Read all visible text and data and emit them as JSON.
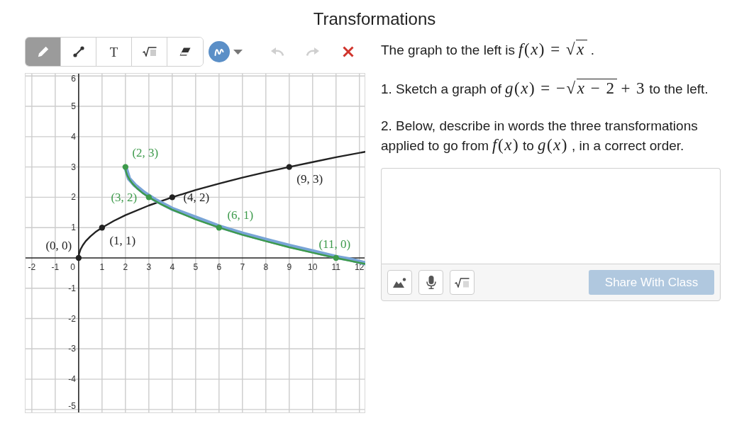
{
  "title": "Transformations",
  "toolbar": {
    "tools": [
      {
        "kind": "pencil",
        "selected": true
      },
      {
        "kind": "segment",
        "selected": false
      },
      {
        "kind": "text",
        "label": "T",
        "selected": false
      },
      {
        "kind": "math",
        "selected": false
      },
      {
        "kind": "eraser",
        "selected": false
      }
    ],
    "color_picker": {
      "color": "#5b8fc7"
    },
    "actions": [
      {
        "kind": "undo",
        "disabled": true
      },
      {
        "kind": "redo",
        "disabled": true
      },
      {
        "kind": "clear",
        "disabled": false
      }
    ]
  },
  "graph": {
    "chart_data": {
      "type": "line",
      "xlim": [
        -2.3,
        12.25
      ],
      "ylim": [
        -5.12,
        6.1
      ],
      "xticks": [
        -2,
        -1,
        0,
        1,
        2,
        3,
        4,
        5,
        6,
        7,
        8,
        9,
        10,
        11,
        12
      ],
      "yticks": [
        -5,
        -4,
        -3,
        -2,
        -1,
        1,
        2,
        3,
        4,
        5,
        6
      ],
      "grid": true,
      "series": [
        {
          "type": "line",
          "color": "#222222",
          "x": [
            0,
            0.02,
            0.08,
            0.18,
            0.3,
            0.5,
            0.75,
            1,
            1.5,
            2,
            3,
            4,
            5,
            6,
            7,
            8,
            9,
            10,
            11,
            12.25
          ],
          "values": [
            0,
            0.14,
            0.28,
            0.42,
            0.55,
            0.71,
            0.87,
            1,
            1.22,
            1.41,
            1.73,
            2,
            2.24,
            2.45,
            2.65,
            2.83,
            3,
            3.16,
            3.32,
            3.5
          ]
        },
        {
          "type": "line",
          "color": "#78a4d6",
          "x": [
            2,
            2.15,
            2.4,
            2.8,
            3.3,
            4,
            5,
            6,
            7,
            8,
            9,
            10,
            11,
            11.6,
            12.25
          ],
          "values": [
            3,
            2.62,
            2.4,
            2.15,
            1.9,
            1.62,
            1.33,
            1.04,
            0.8,
            0.6,
            0.4,
            0.22,
            0.03,
            -0.05,
            -0.18
          ]
        },
        {
          "type": "line",
          "color": "#3d9a4b",
          "x": [
            2,
            2.02,
            2.08,
            2.18,
            2.3,
            2.5,
            2.75,
            3,
            3.5,
            4,
            5,
            6,
            7,
            8,
            9,
            10,
            11,
            12.25
          ],
          "values": [
            3,
            2.86,
            2.72,
            2.58,
            2.45,
            2.29,
            2.13,
            2,
            1.78,
            1.59,
            1.27,
            1,
            0.76,
            0.55,
            0.35,
            0.17,
            0,
            -0.2
          ]
        },
        {
          "type": "scatter",
          "color": "#222222",
          "x": [
            0,
            1,
            4,
            9
          ],
          "values": [
            0,
            1,
            2,
            3
          ],
          "value_labels": [
            "(0, 0)",
            "(1, 1)",
            "(4, 2)",
            "(9, 3)"
          ]
        },
        {
          "type": "scatter",
          "color": "#3d9a4b",
          "x": [
            2,
            3,
            6,
            11
          ],
          "values": [
            3,
            2,
            1,
            0
          ],
          "value_labels": [
            "(2, 3)",
            "(3, 2)",
            "(6, 1)",
            "(11, 0)"
          ]
        }
      ]
    }
  },
  "instructions": [
    {
      "segments": [
        {
          "kind": "text",
          "text": "The graph to the left is"
        },
        {
          "kind": "math",
          "text": "*f*(*x*) = "
        },
        {
          "kind": "sqrt",
          "sign": "√",
          "text": "*x*"
        },
        {
          "kind": "text",
          "text": "."
        }
      ]
    },
    {
      "segments": [
        {
          "kind": "text",
          "text": "1. Sketch a graph of"
        },
        {
          "kind": "math",
          "text": "*g*(*x*) = −"
        },
        {
          "kind": "sqrt",
          "sign": "√",
          "text": "*x* − 2"
        },
        {
          "kind": "math",
          "text": "+ 3"
        },
        {
          "kind": "text",
          "text": "to the left."
        }
      ]
    },
    {
      "segments": [
        {
          "kind": "text",
          "text": "2. Below, describe in words the three transformations applied to go from"
        },
        {
          "kind": "math",
          "text": "*f*(*x*)"
        },
        {
          "kind": "text",
          "text": "to"
        },
        {
          "kind": "math",
          "text": "*g*(*x*)"
        },
        {
          "kind": "text",
          "text": ", in a correct order."
        }
      ]
    }
  ],
  "answer_box": {
    "attachments": [
      {
        "kind": "image"
      },
      {
        "kind": "audio"
      },
      {
        "kind": "math"
      }
    ],
    "share_button": {
      "label": "Share With Class",
      "disabled": true
    }
  }
}
